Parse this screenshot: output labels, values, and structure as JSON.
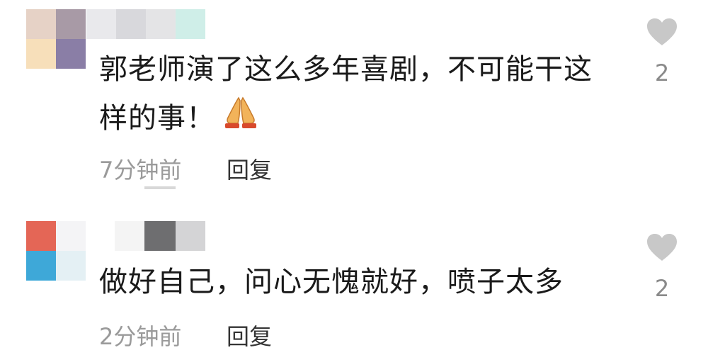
{
  "comments": [
    {
      "text": "郭老师演了这么多年喜剧，不可能干这样的事！",
      "emoji": "folded-hands",
      "time": "7分钟前",
      "reply_label": "回复",
      "likes": "2",
      "avatar_colors": [
        "#e6d2c6",
        "#a89aa6",
        "#f7dfba",
        "#8a7ea6"
      ],
      "name_colors": [
        "#e9e9ec",
        "#d8d8dc",
        "#e4e4e6",
        "#cfeee8"
      ]
    },
    {
      "text": "做好自己，问心无愧就好，喷子太多",
      "time": "2分钟前",
      "reply_label": "回复",
      "likes": "2",
      "avatar_colors": [
        "#e46656",
        "#f4f4f6",
        "#3ea8d8",
        "#e4f0f4"
      ],
      "name_colors": [
        "#f4f4f4",
        "#6e6e70",
        "#d4d4d6"
      ]
    }
  ],
  "colors": {
    "heart": "#c8c8c8",
    "meta": "#9a9a9a",
    "reply": "#333333",
    "text": "#1a1a1a"
  }
}
